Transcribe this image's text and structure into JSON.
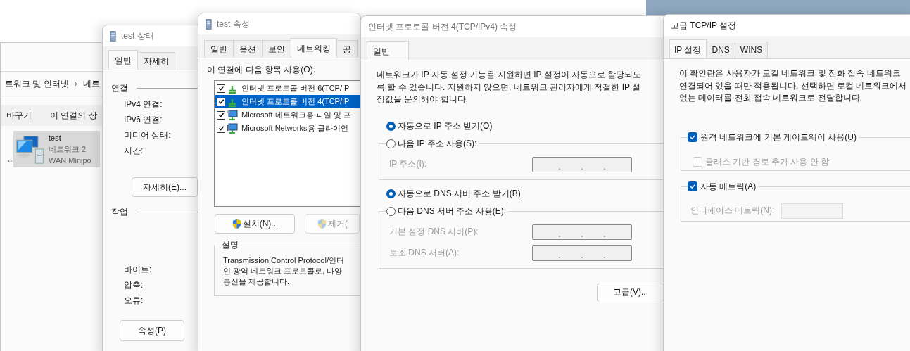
{
  "explorer": {
    "breadcrumb": [
      "트워크 및 인터넷",
      "›",
      "네트"
    ],
    "toolbar": [
      "바꾸기",
      "이 연결의 상"
    ],
    "side_text": "...",
    "connection": {
      "name": "test",
      "lines": [
        "네트워크 2",
        "WAN Minipo"
      ],
      "selected": true
    }
  },
  "status_window": {
    "title": "test 상태",
    "tabs": [
      {
        "label": "일반",
        "selected": true
      },
      {
        "label": "자세히",
        "selected": false
      }
    ],
    "connection_section": {
      "heading": "연결",
      "fields": [
        "IPv4 연결:",
        "IPv6 연결:",
        "미디어 상태:",
        "시간:"
      ],
      "button": "자세히(E)..."
    },
    "activity_section": {
      "heading": "작업",
      "fields": [
        "바이트:",
        "압축:",
        "오류:"
      ]
    },
    "button": "속성(P)"
  },
  "properties_window": {
    "title": "test 속성",
    "tabs": [
      {
        "label": "일반",
        "selected": false
      },
      {
        "label": "옵션",
        "selected": false
      },
      {
        "label": "보안",
        "selected": false
      },
      {
        "label": "네트워킹",
        "selected": true
      },
      {
        "label": "공",
        "selected": false
      }
    ],
    "list_label": "이 연결에 다음 항목 사용(O):",
    "items": [
      {
        "label": "인터넷 프로토콜 버전 6(TCP/IP",
        "checked": true,
        "selected": false,
        "kind": "protocol"
      },
      {
        "label": "인터넷 프로토콜 버전 4(TCP/IP",
        "checked": true,
        "selected": true,
        "kind": "protocol"
      },
      {
        "label": "Microsoft 네트워크용 파일 및 프",
        "checked": true,
        "selected": false,
        "kind": "service"
      },
      {
        "label": "Microsoft Networks용 클라이언",
        "checked": true,
        "selected": false,
        "kind": "client"
      }
    ],
    "buttons": [
      {
        "label": "설치(N)...",
        "disabled": false
      },
      {
        "label": "제거(",
        "disabled": true
      }
    ],
    "description": {
      "heading": "설명",
      "lines": [
        "Transmission Control Protocol/인터",
        "인 광역 네트워크 프로토콜로, 다양",
        "통신을 제공합니다."
      ]
    }
  },
  "ipv4_window": {
    "title": "인터넷 프로토콜 버전 4(TCP/IPv4) 속성",
    "tabs": [
      {
        "label": "일반",
        "selected": true
      }
    ],
    "intro_lines": [
      "네트워크가 IP 자동 설정 기능을 지원하면 IP 설정이 자동으로 할당되도",
      "록 할 수 있습니다. 지원하지 않으면, 네트워크 관리자에게 적절한 IP 설",
      "정값을 문의해야 합니다."
    ],
    "separator": ".",
    "groups": [
      {
        "options": [
          {
            "label": "자동으로 IP 주소 받기(O)",
            "selected": true
          },
          {
            "label": "다음 IP 주소 사용(S):",
            "selected": false
          }
        ],
        "fields": [
          {
            "label": "IP 주소(I):",
            "disabled": true
          }
        ]
      },
      {
        "options": [
          {
            "label": "자동으로 DNS 서버 주소 받기(B)",
            "selected": true
          },
          {
            "label": "다음 DNS 서버 주소 사용(E):",
            "selected": false
          }
        ],
        "fields": [
          {
            "label": "기본 설정 DNS 서버(P):",
            "disabled": true
          },
          {
            "label": "보조 DNS 서버(A):",
            "disabled": true
          }
        ]
      }
    ],
    "advanced_button": "고급(V)..."
  },
  "advanced_window": {
    "title": "고급 TCP/IP 설정",
    "tabs": [
      {
        "label": "IP 설정",
        "selected": true
      },
      {
        "label": "DNS",
        "selected": false
      },
      {
        "label": "WINS",
        "selected": false
      }
    ],
    "intro_lines": [
      "이 확인란은 사용자가 로컬 네트워크 및 전화 접속 네트워크",
      "연결되어 있을 때만 적용됩니다. 선택하면 로컬 네트워크에서",
      "없는 데이터를 전화 접속 네트워크로 전달합니다."
    ],
    "gateway_group": {
      "option": {
        "label": "원격 네트워크에 기본 게이트웨이 사용(U)",
        "checked": true,
        "disabled": false
      },
      "sub_option": {
        "label": "클래스 기반 경로 추가 사용 안 함",
        "checked": false,
        "disabled": true
      }
    },
    "metric_group": {
      "option": {
        "label": "자동 메트릭(A)",
        "checked": true,
        "disabled": false
      },
      "field": {
        "label": "인터페이스 메트릭(N):",
        "disabled": true
      }
    }
  }
}
